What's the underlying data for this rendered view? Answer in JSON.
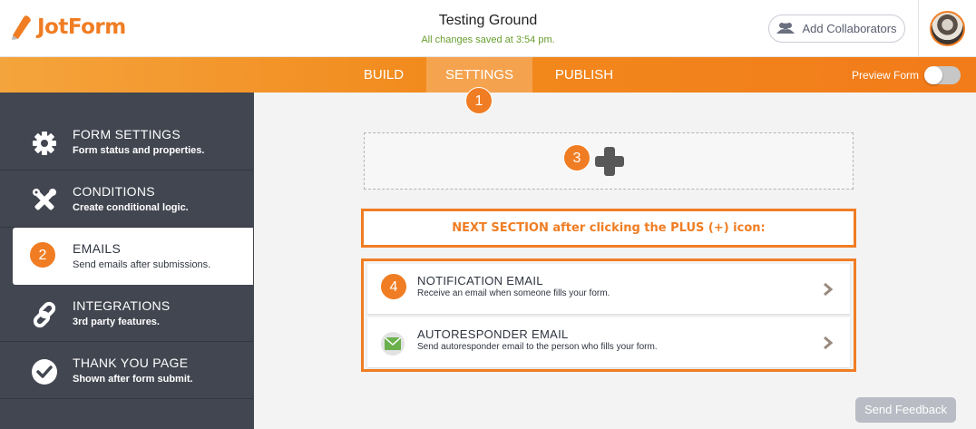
{
  "app": {
    "logo_text": "JotForm",
    "form_title": "Testing Ground",
    "save_status": "All changes saved at 3:54 pm.",
    "collab_label": "Add Collaborators",
    "brand_color": "#f07d23"
  },
  "nav": {
    "tabs": [
      {
        "label": "BUILD"
      },
      {
        "label": "SETTINGS",
        "active": true
      },
      {
        "label": "PUBLISH"
      }
    ],
    "preview_label": "Preview Form",
    "preview_on": false
  },
  "badges": {
    "settings": "1",
    "emails": "2",
    "plus": "3",
    "notification": "4"
  },
  "sidebar": {
    "items": [
      {
        "title": "FORM SETTINGS",
        "subtitle": "Form status and properties.",
        "icon": "gear-icon"
      },
      {
        "title": "CONDITIONS",
        "subtitle": "Create conditional logic.",
        "icon": "tools-icon"
      },
      {
        "title": "EMAILS",
        "subtitle": "Send emails after submissions.",
        "icon": "email-icon",
        "active": true
      },
      {
        "title": "INTEGRATIONS",
        "subtitle": "3rd party features.",
        "icon": "link-icon"
      },
      {
        "title": "THANK YOU PAGE",
        "subtitle": "Shown after form submit.",
        "icon": "check-circle-icon"
      }
    ]
  },
  "main": {
    "next_section_text": "NEXT SECTION after clicking the PLUS (+) icon:",
    "emails": [
      {
        "title": "NOTIFICATION EMAIL",
        "subtitle": "Receive an email when someone fills your form."
      },
      {
        "title": "AUTORESPONDER EMAIL",
        "subtitle": "Send autoresponder email to the person who fills your form."
      }
    ]
  },
  "feedback_label": "Send Feedback"
}
